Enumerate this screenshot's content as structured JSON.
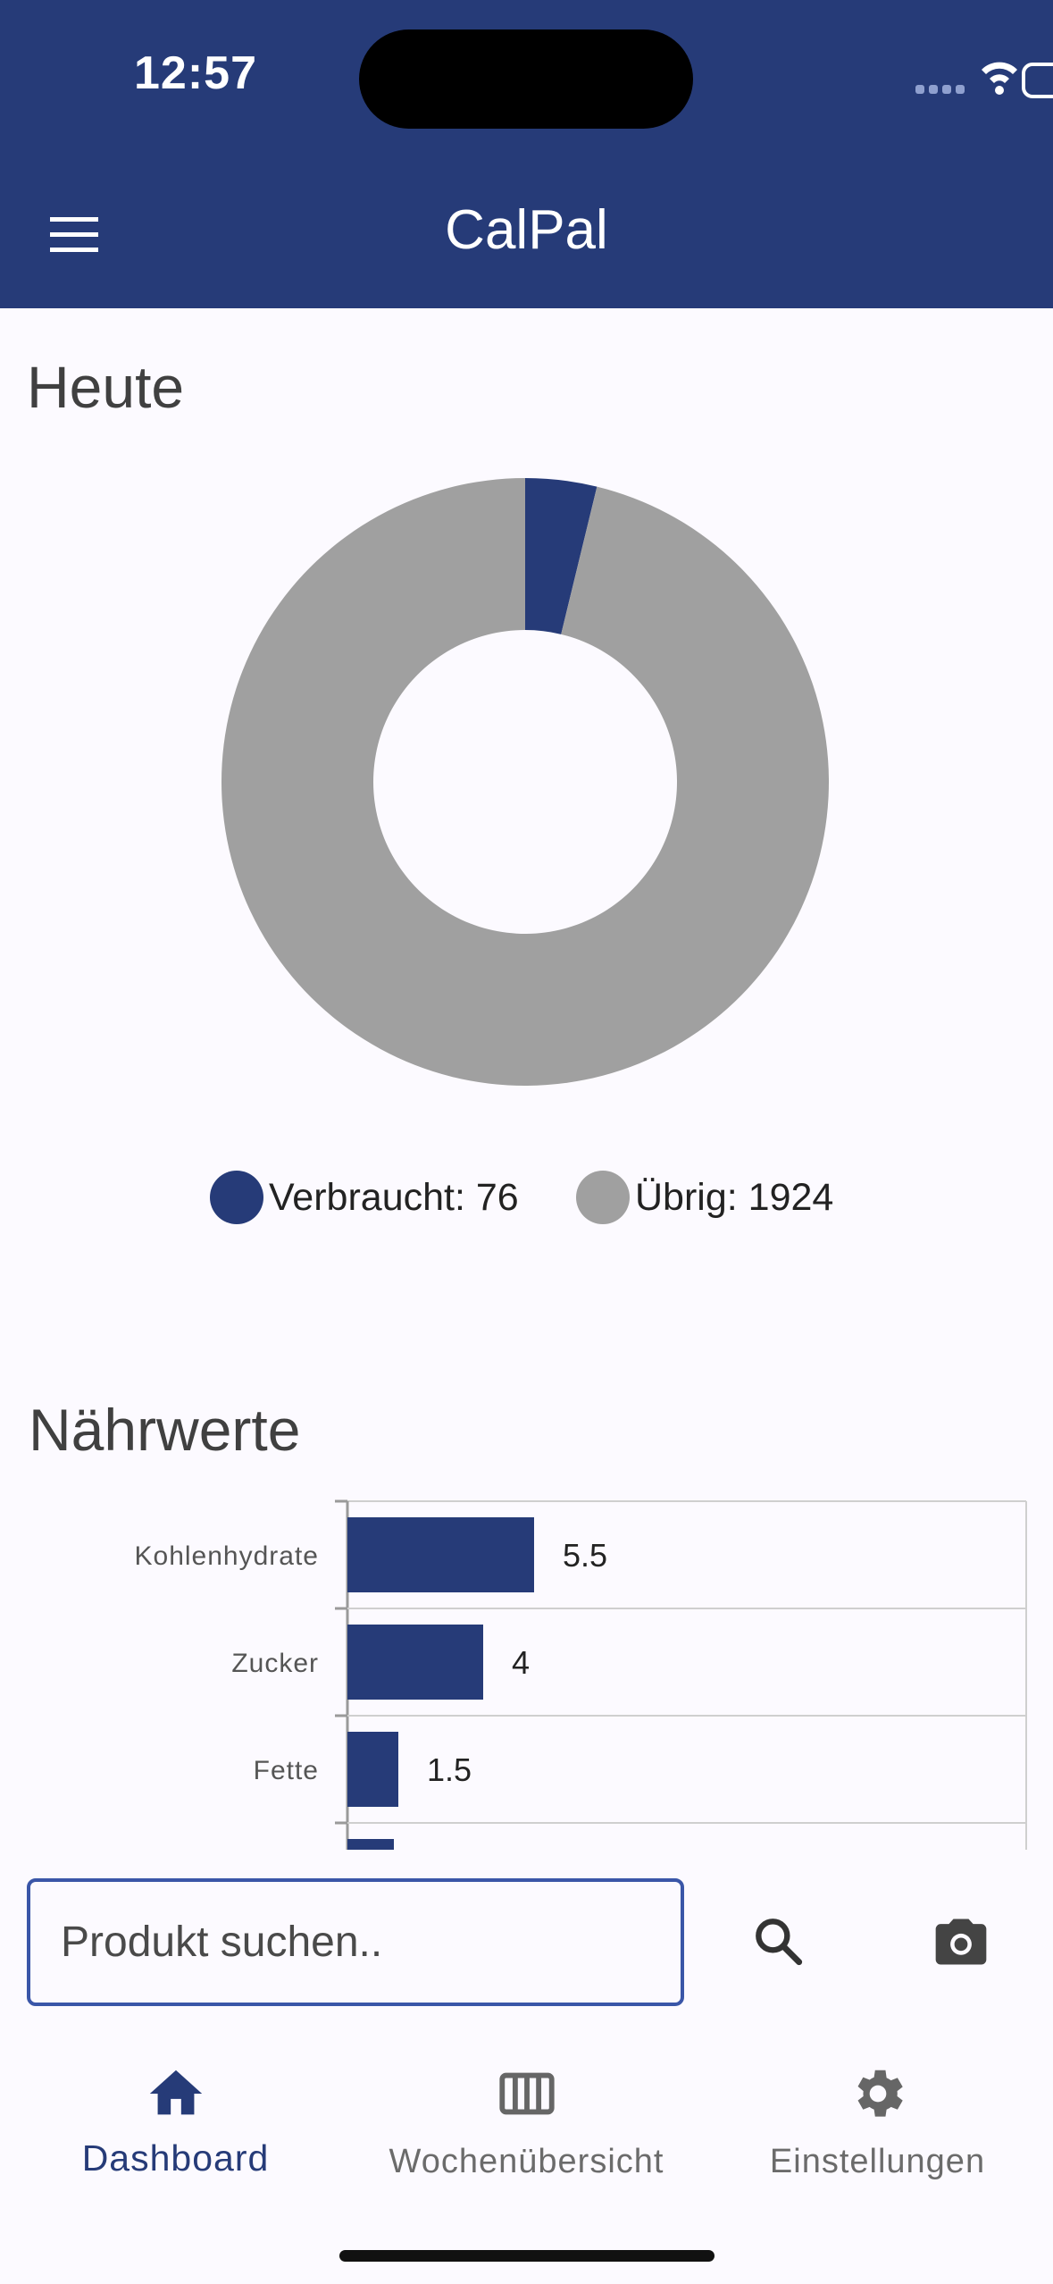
{
  "status_bar": {
    "time": "12:57"
  },
  "app": {
    "title": "CalPal"
  },
  "today": {
    "title": "Heute",
    "chart_data": {
      "type": "pie",
      "donut": true,
      "slices": [
        {
          "label": "Verbraucht",
          "value": 76,
          "color": "#263b78"
        },
        {
          "label": "Übrig",
          "value": 1924,
          "color": "#a0a0a0"
        }
      ],
      "legend_position": "bottom"
    },
    "legend": [
      {
        "text": "Verbraucht: 76",
        "color": "#263b78"
      },
      {
        "text": "Übrig: 1924",
        "color": "#a0a0a0"
      }
    ]
  },
  "nutrients": {
    "title": "Nährwerte",
    "chart_data": {
      "type": "bar",
      "orientation": "horizontal",
      "categories": [
        "Kohlenhydrate",
        "Zucker",
        "Fette"
      ],
      "values": [
        5.5,
        4,
        1.5
      ],
      "value_labels": [
        "5.5",
        "4",
        "1.5"
      ],
      "color": "#263b78",
      "xlim": [
        0,
        20
      ],
      "grid": true
    }
  },
  "search": {
    "placeholder": "Produkt suchen.."
  },
  "icons": {
    "menu": "menu-icon",
    "search": "search-icon",
    "camera": "camera-icon",
    "home": "home-icon",
    "week": "calendar-view-week-icon",
    "settings": "gear-icon"
  },
  "nav": {
    "items": [
      {
        "label": "Dashboard",
        "active": true
      },
      {
        "label": "Wochenübersicht",
        "active": false
      },
      {
        "label": "Einstellungen",
        "active": false
      }
    ]
  },
  "colors": {
    "primary": "#263b78",
    "remaining": "#a0a0a0",
    "background": "#fcfaff"
  }
}
